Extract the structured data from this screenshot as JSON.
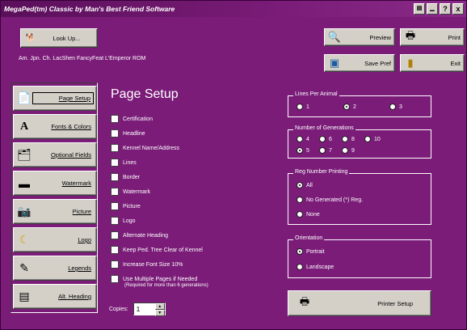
{
  "window": {
    "title": "MegaPed(tm) Classic by Man's Best Friend Software"
  },
  "titlebar_buttons": [
    "?",
    "x"
  ],
  "toolbar": {
    "lookup_label": "Look Up...",
    "preview_label": "Preview",
    "print_label": "Print",
    "save_pref_label": "Save Pref",
    "exit_label": "Exit"
  },
  "dog": {
    "name": "Am. Jpn. Ch. LacShen FancyFeat L'Emperor ROM"
  },
  "sidebar": {
    "items": [
      {
        "label": "Page Setup",
        "icon": "page-icon",
        "active": true
      },
      {
        "label": "Fonts & Colors",
        "icon": "font-icon"
      },
      {
        "label": "Optional Fields",
        "icon": "fields-icon"
      },
      {
        "label": "Watermark",
        "icon": "watermark-icon"
      },
      {
        "label": "Picture",
        "icon": "picture-icon"
      },
      {
        "label": "Logo",
        "icon": "logo-icon"
      },
      {
        "label": "Legends",
        "icon": "legends-icon"
      },
      {
        "label": "Alt. Heading",
        "icon": "heading-icon"
      }
    ]
  },
  "page_setup": {
    "title": "Page Setup",
    "options": [
      "Certification",
      "Headline",
      "Kennel Name/Address",
      "Lines",
      "Border",
      "Watermark",
      "Picture",
      "Logo",
      "Alternate Heading",
      "Keep Ped. Tree Clear of Kennel",
      "Increase Font Size 10%",
      "Use Multiple Pages if Needed"
    ],
    "multi_page_note": "(Required for more than 6 generations)",
    "copies_label": "Copies:",
    "copies_value": "1"
  },
  "lines_per_animal": {
    "title": "Lines Per Animal",
    "options": [
      "1",
      "2",
      "3"
    ],
    "selected": "2"
  },
  "generations": {
    "title": "Number of Generations",
    "options": [
      "4",
      "6",
      "8",
      "10",
      "5",
      "7",
      "9"
    ],
    "selected": "5"
  },
  "reg_number": {
    "title": "Reg Number Printing",
    "options": [
      "All",
      "No Generated (*) Reg.",
      "None"
    ],
    "selected": "All"
  },
  "orientation": {
    "title": "Orientation",
    "options": [
      "Portrait",
      "Landscape"
    ],
    "selected": "Portrait"
  },
  "printer_setup_label": "Printer Setup",
  "colors": {
    "window_bg": "#7a1c78",
    "button_face": "#d4d0c8"
  }
}
